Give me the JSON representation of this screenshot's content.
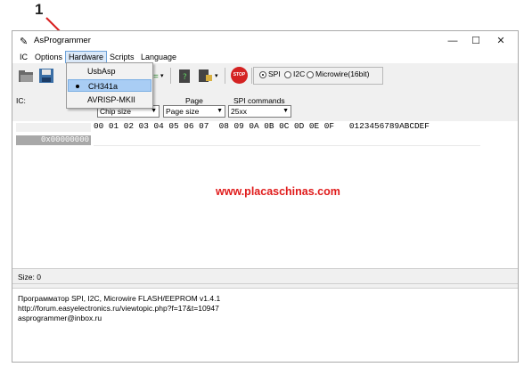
{
  "annotation": {
    "number": "1"
  },
  "window": {
    "title": "AsProgrammer",
    "controls": {
      "minimize": "—",
      "maximize": "☐",
      "close": "✕"
    }
  },
  "menubar": {
    "items": [
      "IC",
      "Options",
      "Hardware",
      "Scripts",
      "Language"
    ],
    "active": "Hardware"
  },
  "hardware_menu": {
    "items": [
      {
        "label": "UsbAsp",
        "checked": false
      },
      {
        "label": "CH341a",
        "checked": true
      },
      {
        "label": "AVRISP-MKII",
        "checked": false
      }
    ]
  },
  "toolbar": {
    "stop_label": "STOP",
    "protocols": [
      {
        "label": "SPI",
        "selected": true
      },
      {
        "label": "I2C",
        "selected": false
      },
      {
        "label": "Microwire(16bit)",
        "selected": false
      }
    ]
  },
  "params": {
    "ic_label": "IC:",
    "page_label": "Page",
    "spi_commands_label": "SPI commands",
    "chip_size": "Chip size",
    "page_size": "Page size",
    "spi_commands": "25xx"
  },
  "hex": {
    "header": "00 01 02 03 04 05 06 07  08 09 0A 0B 0C 0D 0E 0F   0123456789ABCDEF",
    "address": "0x00000000"
  },
  "watermark": "www.placaschinas.com",
  "status": {
    "size": "Size: 0"
  },
  "log": {
    "lines": [
      "Программатор SPI, I2C, Microwire FLASH/EEPROM v1.4.1",
      "http://forum.easyelectronics.ru/viewtopic.php?f=17&t=10947",
      "asprogrammer@inbox.ru"
    ]
  },
  "colors": {
    "accent": "#0078d7",
    "watermark": "#e01b1b",
    "menu_highlight": "#dbe9f8",
    "dropdown_selected": "#a9cdf4"
  }
}
